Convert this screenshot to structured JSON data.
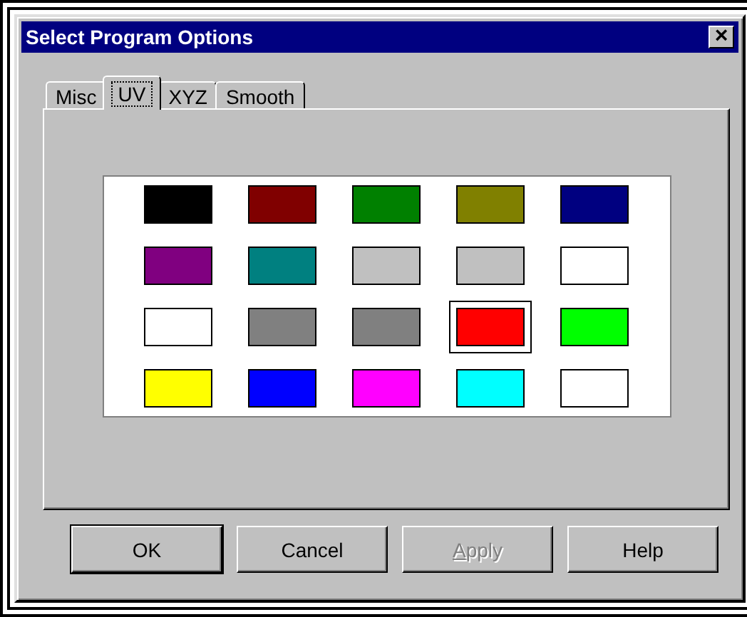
{
  "window": {
    "title": "Select Program Options",
    "close": "×"
  },
  "tabs": [
    {
      "label": "Misc",
      "selected": false
    },
    {
      "label": "UV",
      "selected": true
    },
    {
      "label": "XYZ",
      "selected": false
    },
    {
      "label": "Smooth",
      "selected": false
    }
  ],
  "swatches": [
    {
      "color": "#000000",
      "selected": false
    },
    {
      "color": "#800000",
      "selected": false
    },
    {
      "color": "#008000",
      "selected": false
    },
    {
      "color": "#808000",
      "selected": false
    },
    {
      "color": "#000080",
      "selected": false
    },
    {
      "color": "#800080",
      "selected": false
    },
    {
      "color": "#008080",
      "selected": false
    },
    {
      "color": "#c0c0c0",
      "selected": false
    },
    {
      "color": "#c0c0c0",
      "selected": false
    },
    {
      "color": "#ffffff",
      "selected": false
    },
    {
      "color": "#ffffff",
      "selected": false
    },
    {
      "color": "#808080",
      "selected": false
    },
    {
      "color": "#808080",
      "selected": false
    },
    {
      "color": "#ff0000",
      "selected": true
    },
    {
      "color": "#00ff00",
      "selected": false
    },
    {
      "color": "#ffff00",
      "selected": false
    },
    {
      "color": "#0000ff",
      "selected": false
    },
    {
      "color": "#ff00ff",
      "selected": false
    },
    {
      "color": "#00ffff",
      "selected": false
    },
    {
      "color": "#ffffff",
      "selected": false
    }
  ],
  "buttons": [
    {
      "label": "OK",
      "default": true,
      "disabled": false
    },
    {
      "label": "Cancel",
      "default": false,
      "disabled": false
    },
    {
      "label": "Apply",
      "default": false,
      "disabled": true
    },
    {
      "label": "Help",
      "default": false,
      "disabled": false
    }
  ]
}
